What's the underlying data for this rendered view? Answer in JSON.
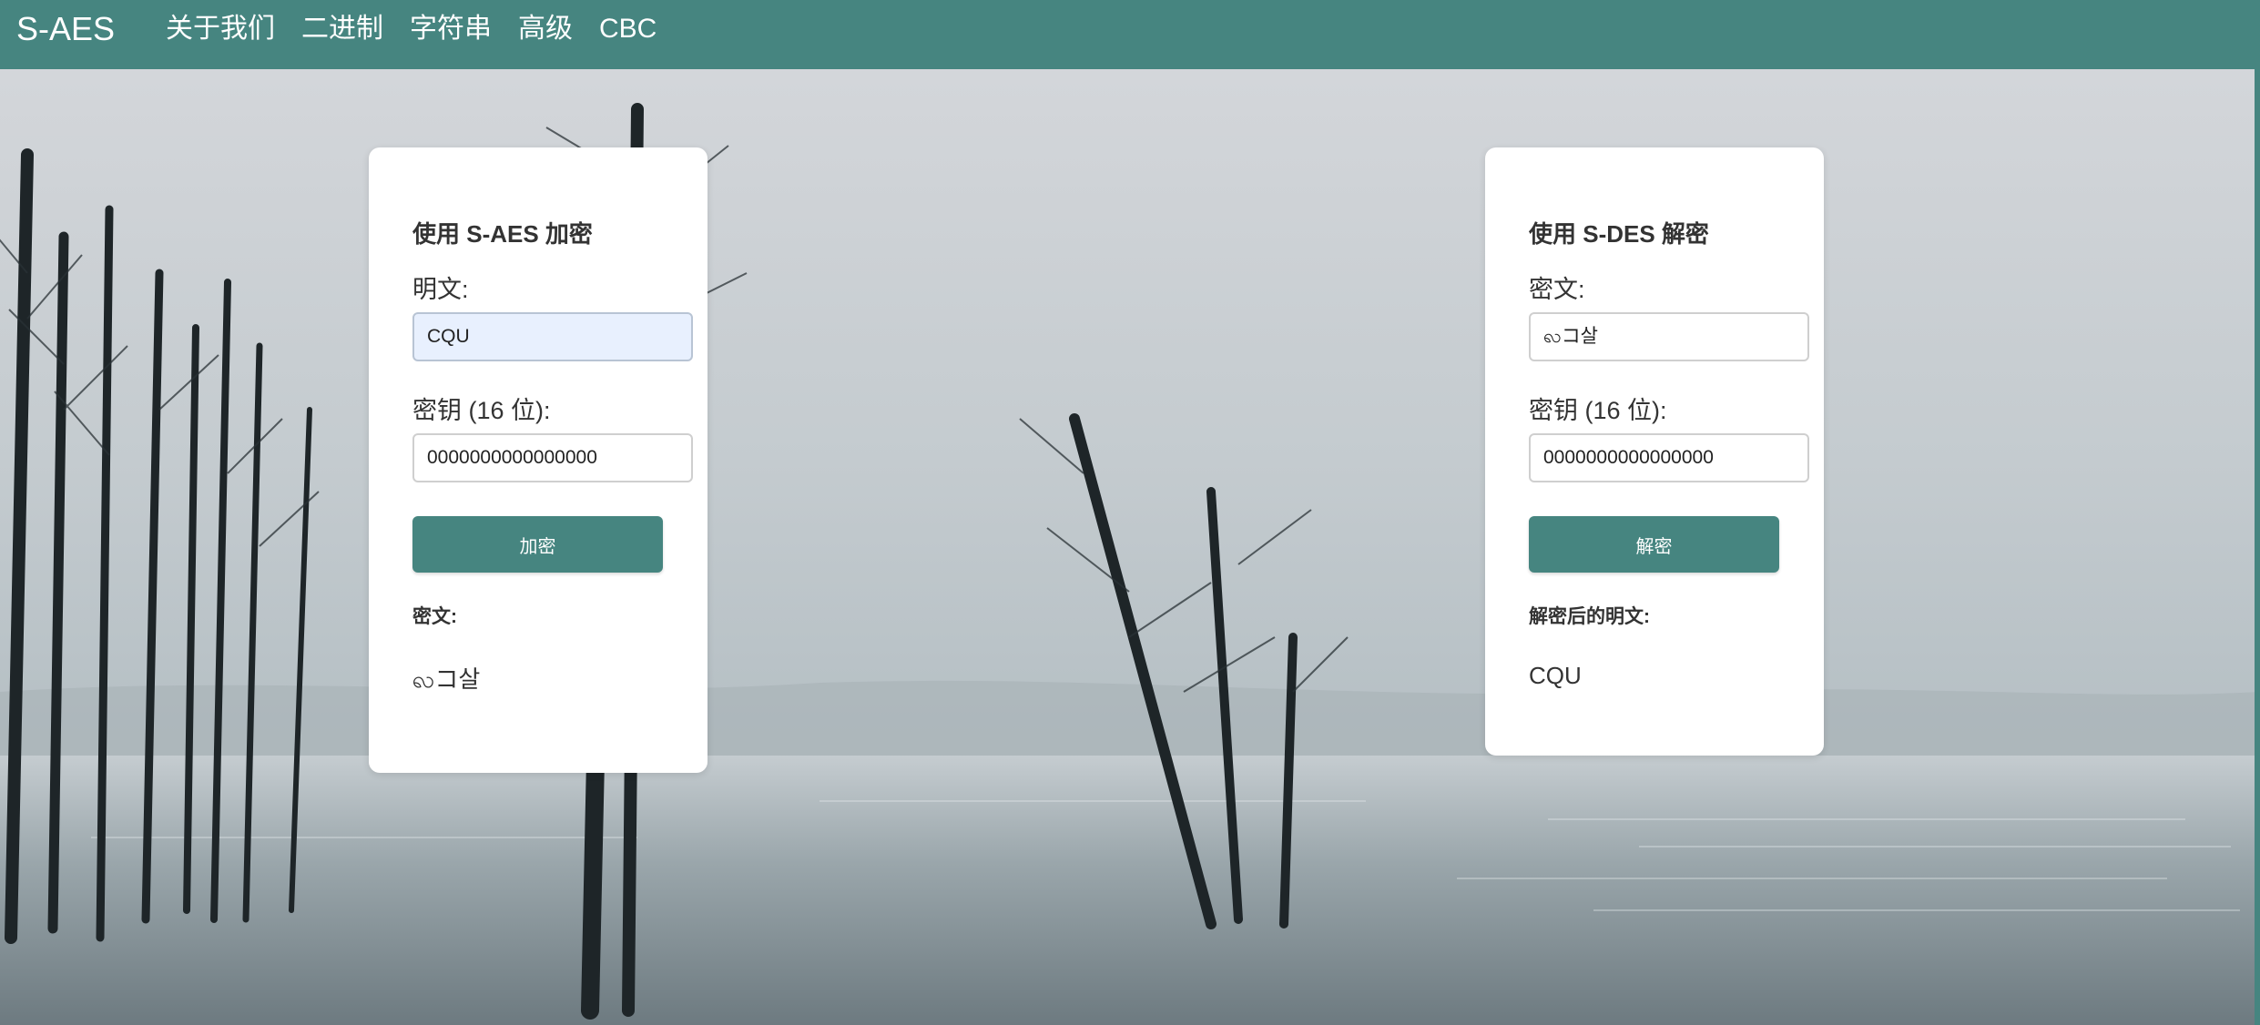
{
  "app": {
    "brand": "S-AES"
  },
  "nav": {
    "items": [
      {
        "label": "关于我们"
      },
      {
        "label": "二进制"
      },
      {
        "label": "字符串"
      },
      {
        "label": "高级"
      },
      {
        "label": "CBC"
      }
    ]
  },
  "encrypt": {
    "title": "使用 S-AES 加密",
    "plaintext_label": "明文:",
    "plaintext_value": "CQU",
    "key_label": "密钥 (16 位):",
    "key_value": "0000000000000000",
    "button_label": "加密",
    "result_label": "密文:",
    "result_value": "ꩮコ살"
  },
  "decrypt": {
    "title": "使用 S-DES 解密",
    "ciphertext_label": "密文:",
    "ciphertext_value": "ꩮコ살",
    "key_label": "密钥 (16 位):",
    "key_value": "0000000000000000",
    "button_label": "解密",
    "result_label": "解密后的明文:",
    "result_value": "CQU"
  },
  "colors": {
    "accent": "#468580",
    "card_bg": "#ffffff",
    "text": "#333333",
    "filled_input_bg": "#e8f0fe"
  }
}
